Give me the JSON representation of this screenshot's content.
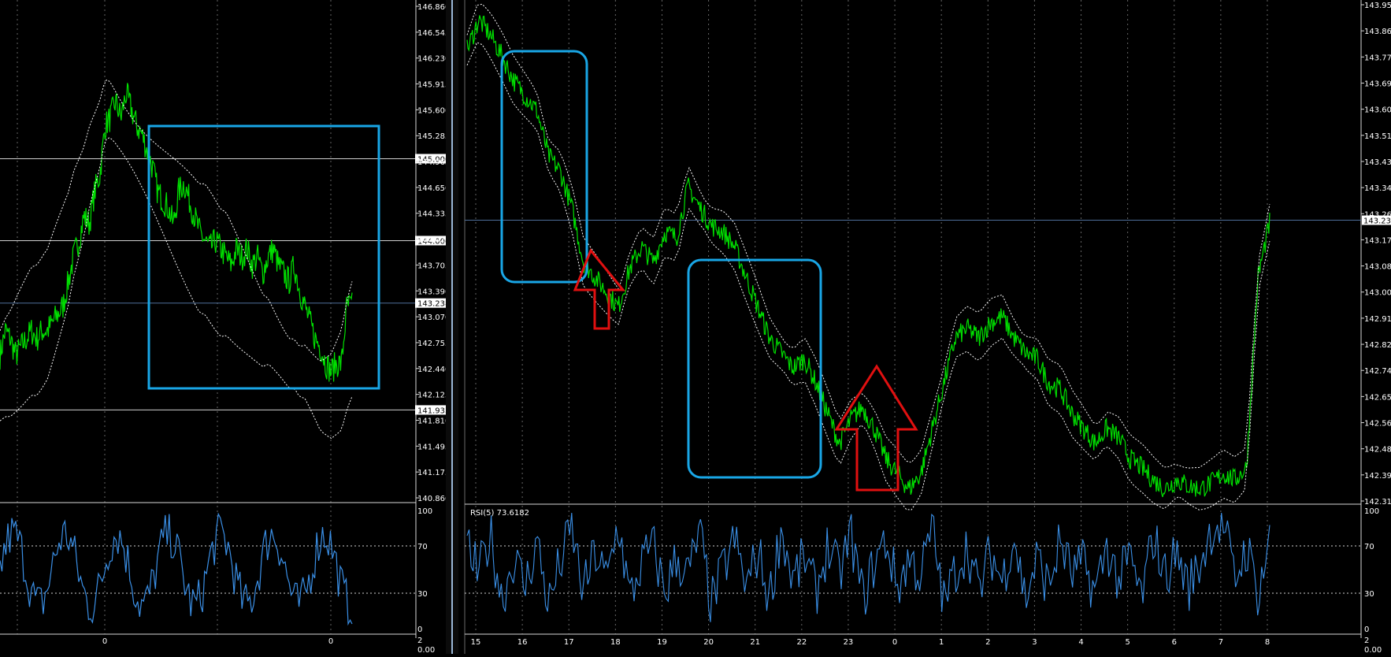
{
  "colors": {
    "background": "#000000",
    "price": "#00e000",
    "band": "#ffffff",
    "rsi": "#3a8fe6",
    "box": "#19a6e6",
    "arrow": "#e01010",
    "axis": "#ffffff"
  },
  "left_chart": {
    "price_ticks": [
      "146.860",
      "146.545",
      "146.230",
      "145.915",
      "145.600",
      "145.285",
      "144.965",
      "144.650",
      "144.335",
      "144.020",
      "143.705",
      "143.390",
      "143.070",
      "142.755",
      "142.440",
      "142.125",
      "141.810",
      "141.495",
      "141.175",
      "140.860"
    ],
    "level_labels": [
      "145.000",
      "144.000",
      "143.238",
      "141.933"
    ],
    "time_labels": [
      "0",
      "0"
    ],
    "rsi_ticks": [
      "100",
      "70",
      "30",
      "0"
    ],
    "footer_ticks": [
      "2",
      "0.00"
    ]
  },
  "right_chart": {
    "price_ticks": [
      "143.950",
      "143.860",
      "143.775",
      "143.690",
      "143.605",
      "143.515",
      "143.430",
      "143.345",
      "143.260",
      "143.170",
      "143.085",
      "143.000",
      "142.910",
      "142.825",
      "142.740",
      "142.655",
      "142.565",
      "142.480",
      "142.395",
      "142.310"
    ],
    "level_labels": [
      "143.238"
    ],
    "rsi_label": "RSI(5) 73.6182",
    "time_labels": [
      "15",
      "16",
      "17",
      "18",
      "19",
      "20",
      "21",
      "22",
      "23",
      "0",
      "1",
      "2",
      "3",
      "4",
      "5",
      "6",
      "7",
      "8"
    ],
    "rsi_ticks": [
      "100",
      "70",
      "30",
      "0"
    ],
    "footer_ticks": [
      "2",
      "0.00"
    ]
  },
  "chart_data": [
    {
      "type": "line",
      "title": "",
      "ylim": [
        140.86,
        146.86
      ],
      "levels": [
        145.0,
        144.0,
        143.238,
        141.933
      ],
      "x": [
        0,
        6,
        12,
        18,
        24,
        30,
        36,
        42,
        48,
        54,
        60,
        66,
        72,
        78,
        84,
        90,
        96,
        102,
        108,
        114,
        120,
        126,
        132,
        138,
        144,
        150,
        156,
        162,
        168,
        174,
        180,
        186,
        192,
        198,
        204,
        210,
        216,
        222,
        228,
        234,
        240,
        246,
        252,
        258,
        264,
        270,
        276,
        282,
        288,
        294,
        300,
        306,
        312,
        318,
        324,
        330,
        336,
        342,
        348,
        354,
        360,
        366,
        372,
        378,
        384,
        390,
        396,
        402
      ],
      "series": [
        {
          "values": [
            142.6,
            142.9,
            142.8,
            142.6,
            142.7,
            142.8,
            142.9,
            142.8,
            142.9,
            142.9,
            143.0,
            143.1,
            143.2,
            143.5,
            143.8,
            144.0,
            144.3,
            144.2,
            144.6,
            144.8,
            145.4,
            145.5,
            145.7,
            145.5,
            145.8,
            145.6,
            145.4,
            145.3,
            145.1,
            144.9,
            144.6,
            144.5,
            144.4,
            144.2,
            144.6,
            144.7,
            144.5,
            144.3,
            144.1,
            144.0,
            143.9,
            144.0,
            143.9,
            143.8,
            143.7,
            143.9,
            143.8,
            143.9,
            143.7,
            143.8,
            143.6,
            143.8,
            143.9,
            143.7,
            143.6,
            143.5,
            143.7,
            143.4,
            143.2,
            143.0,
            142.8,
            142.7,
            142.5,
            142.4,
            142.5,
            142.5,
            143.2,
            143.2
          ]
        },
        {
          "name": "",
          "values": [
            142.35,
            142.45,
            142.5,
            142.6,
            142.7,
            142.8,
            142.9,
            142.9,
            143.0,
            143.1,
            143.3,
            143.5,
            143.7,
            143.9,
            144.2,
            144.4,
            144.6,
            144.9,
            145.1,
            145.3,
            145.6,
            145.6,
            145.5,
            145.4,
            145.3,
            145.2,
            145.1,
            145.0,
            144.9,
            144.8,
            144.7,
            144.6,
            144.5,
            144.4,
            144.3,
            144.2,
            144.1,
            144.0,
            143.9,
            143.9,
            143.8,
            143.7,
            143.6,
            143.6,
            143.5,
            143.4,
            143.3,
            143.2,
            143.1,
            143.0,
            142.9,
            142.9,
            142.8,
            142.7,
            142.6,
            142.5,
            142.5,
            142.4,
            142.4,
            142.3,
            142.2,
            142.1,
            142.1,
            142.1,
            142.2,
            142.3,
            142.6,
            142.8
          ]
        }
      ]
    },
    {
      "type": "line",
      "title": "",
      "ylim": [
        142.31,
        143.95
      ],
      "levels": [
        143.238
      ],
      "categories": [
        "15",
        "16",
        "17",
        "18",
        "19",
        "20",
        "21",
        "22",
        "23",
        "0",
        "1",
        "2",
        "3",
        "4",
        "5",
        "6",
        "7",
        "8"
      ],
      "series": [
        {
          "values": [
            143.8,
            143.9,
            143.85,
            143.78,
            143.7,
            143.65,
            143.6,
            143.45,
            143.4,
            143.28,
            143.1,
            143.05,
            143.0,
            142.95,
            143.08,
            143.15,
            143.1,
            143.2,
            143.18,
            143.35,
            143.28,
            143.22,
            143.2,
            143.15,
            143.05,
            142.95,
            142.85,
            142.8,
            142.75,
            142.78,
            142.7,
            142.6,
            142.5,
            142.58,
            142.62,
            142.55,
            142.45,
            142.4,
            142.35,
            142.4,
            142.55,
            142.7,
            142.85,
            142.88,
            142.85,
            142.9,
            142.92,
            142.85,
            142.8,
            142.78,
            142.7,
            142.68,
            142.6,
            142.55,
            142.5,
            142.55,
            142.52,
            142.45,
            142.42,
            142.38,
            142.35,
            142.38,
            142.36,
            142.35,
            142.37,
            142.4,
            142.38,
            142.42,
            143.05,
            143.23
          ]
        },
        {
          "name": "RSI(5)",
          "values": [
            70,
            45,
            80,
            25,
            60,
            35,
            75,
            20,
            55,
            85,
            30,
            65,
            40,
            90,
            25,
            55,
            70,
            30,
            60,
            45,
            80,
            20,
            50,
            75,
            35,
            65,
            25,
            85,
            40,
            60,
            30,
            70,
            45,
            80,
            25,
            55,
            75,
            35,
            60,
            45,
            85,
            20,
            50,
            70,
            30,
            65,
            40,
            80,
            25,
            60,
            35,
            75,
            45,
            55,
            30,
            70,
            40,
            60,
            25,
            80,
            45,
            65,
            35,
            55,
            85,
            90,
            40,
            70,
            30,
            73.6
          ]
        }
      ]
    }
  ]
}
